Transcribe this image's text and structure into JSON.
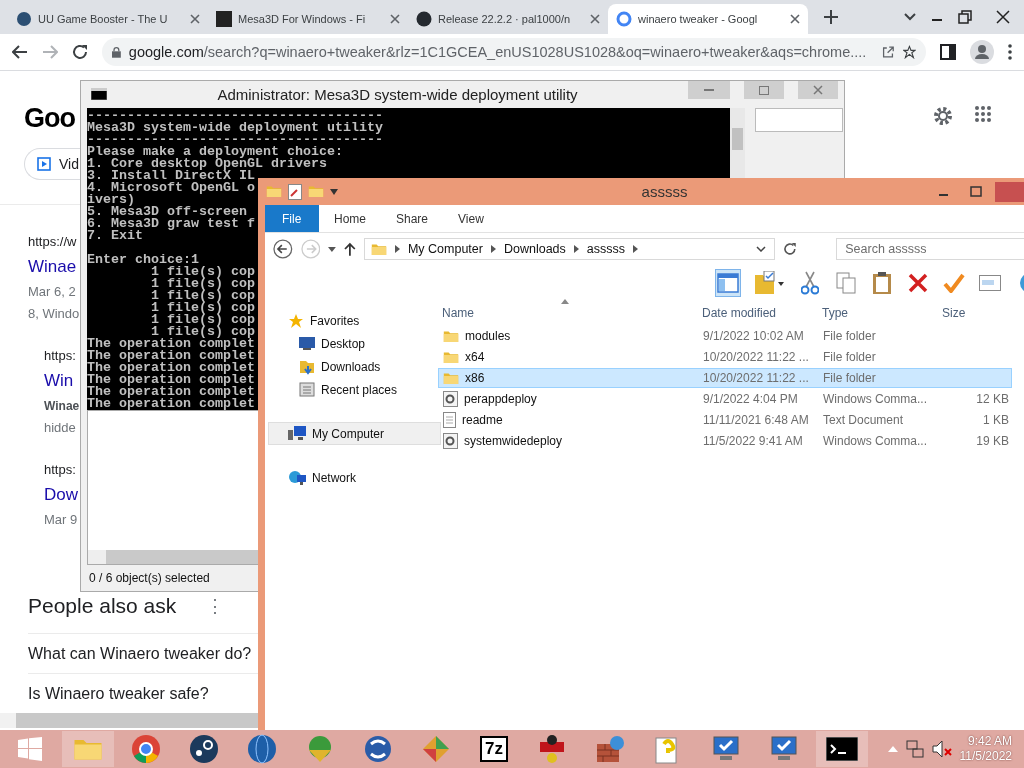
{
  "browser": {
    "tabs": [
      {
        "title": "UU Game Booster - The U",
        "selected": false
      },
      {
        "title": "Mesa3D For Windows - Fi",
        "selected": false
      },
      {
        "title": "Release 22.2.2 · pal1000/n",
        "selected": false
      },
      {
        "title": "winaero tweaker - Googl",
        "selected": true
      }
    ],
    "address": {
      "domain": "google.com",
      "path": "/search?q=winaero+tweaker&rlz=1C1GCEA_enUS1028US1028&oq=winaero+tweaker&aqs=chrome...."
    }
  },
  "google": {
    "logo": "Goo",
    "chip": "Vid",
    "results": [
      {
        "nested": false,
        "lines": [
          {
            "kind": "url",
            "text": "https://w"
          },
          {
            "kind": "title",
            "text": "Winae"
          },
          {
            "kind": "meta",
            "text": "Mar 6, 2"
          },
          {
            "kind": "meta",
            "text": "8, Windo"
          }
        ]
      },
      {
        "nested": true,
        "lines": [
          {
            "kind": "url",
            "text": "https:"
          },
          {
            "kind": "title",
            "text": "Win"
          },
          {
            "kind": "bold",
            "text": "Winae"
          },
          {
            "kind": "meta",
            "text": "hidde"
          }
        ]
      },
      {
        "nested": true,
        "lines": [
          {
            "kind": "url",
            "text": "https:"
          },
          {
            "kind": "title",
            "text": "Dow"
          },
          {
            "kind": "meta",
            "text": "Mar 9"
          }
        ]
      }
    ],
    "people_also_ask": {
      "title": "People also ask",
      "menu": "⋮",
      "questions": [
        "What can Winaero tweaker do?",
        "Is Winaero tweaker safe?"
      ]
    }
  },
  "console": {
    "title": "Administrator:  Mesa3D system-wide deployment utility",
    "wide_lines": [
      "-------------------------------------",
      "Mesa3D system-wide deployment utility",
      "-------------------------------------",
      "Please make a deployment choice:",
      "1. Core desktop OpenGL drivers"
    ],
    "lines": [
      "3. Install DirectX IL",
      "4. Microsoft OpenGL o",
      "ivers)",
      "5. Mesa3D off-screen",
      "6. Mesa3D graw test f",
      "7. Exit"
    ],
    "log_lines": [
      "Enter choice:1",
      "        1 file(s) cop",
      "        1 file(s) cop",
      "        1 file(s) cop",
      "        1 file(s) cop",
      "        1 file(s) cop",
      "        1 file(s) cop",
      "The operation complet",
      "The operation complet",
      "The operation complet",
      "The operation complet",
      "The operation complet",
      "The operation complet"
    ],
    "status": "0 / 6 object(s) selected"
  },
  "explorer": {
    "title": "asssss",
    "ribbon_tabs": [
      {
        "label": "File",
        "selected": true
      },
      {
        "label": "Home",
        "selected": false
      },
      {
        "label": "Share",
        "selected": false
      },
      {
        "label": "View",
        "selected": false
      }
    ],
    "breadcrumb": [
      "My Computer",
      "Downloads",
      "asssss"
    ],
    "search_placeholder": "Search asssss",
    "nav": [
      {
        "label": "Favorites",
        "kind": "favorites",
        "selected": false,
        "children": [
          {
            "label": "Desktop",
            "kind": "desktop",
            "selected": false
          },
          {
            "label": "Downloads",
            "kind": "downloads",
            "selected": false
          },
          {
            "label": "Recent places",
            "kind": "recent",
            "selected": false
          }
        ]
      },
      {
        "label": "My Computer",
        "kind": "computer",
        "selected": true
      },
      {
        "label": "Network",
        "kind": "network",
        "selected": false
      }
    ],
    "columns": [
      "Name",
      "Date modified",
      "Type",
      "Size"
    ],
    "files": [
      {
        "kind": "folder",
        "name": "modules",
        "date": "9/1/2022 10:02 AM",
        "type": "File folder",
        "selected": false
      },
      {
        "kind": "folder",
        "name": "x64",
        "date": "10/20/2022 11:22 ...",
        "type": "File folder",
        "selected": false
      },
      {
        "kind": "folder",
        "name": "x86",
        "date": "10/20/2022 11:22 ...",
        "type": "File folder",
        "selected": true
      },
      {
        "kind": "script",
        "name": "perappdeploy",
        "date": "9/1/2022 4:04 PM",
        "type": "Windows Comma...",
        "size": "12 KB",
        "selected": false
      },
      {
        "kind": "text",
        "name": "readme",
        "date": "11/11/2021 6:48 AM",
        "type": "Text Document",
        "size": "1 KB",
        "selected": false
      },
      {
        "kind": "script",
        "name": "systemwidedeploy",
        "date": "11/5/2022 9:41 AM",
        "type": "Windows Comma...",
        "size": "19 KB",
        "selected": false
      }
    ]
  },
  "taskbar": {
    "sevenzip_label": "7z",
    "time": "9:42 AM",
    "date": "11/5/2022"
  }
}
